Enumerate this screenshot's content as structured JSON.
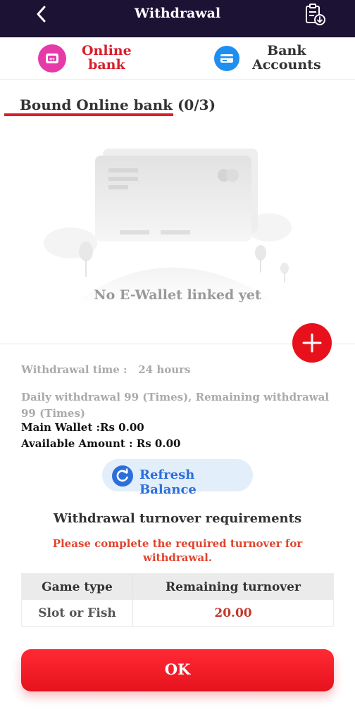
{
  "header": {
    "title": "Withdrawal",
    "back_icon": "chevron-left-icon",
    "record_icon": "clipboard-download-icon"
  },
  "tabs": [
    {
      "line1": "Online",
      "line2": "bank",
      "icon": "e-wallet-icon",
      "active": true
    },
    {
      "line1": "Bank",
      "line2": "Accounts",
      "icon": "bank-card-icon",
      "active": false
    }
  ],
  "bound": {
    "title": "Bound Online bank (0/3)",
    "empty_text": "No E-Wallet linked yet"
  },
  "add_icon": "plus-icon",
  "info": {
    "time_label": "Withdrawal time :   24 hours",
    "daily": "Daily withdrawal 99 (Times), Remaining withdrawal 99 (Times)",
    "main_wallet_label": "Main Wallet :",
    "main_wallet_value": "Rs 0.00",
    "available_label": "Available Amount : ",
    "available_value": "Rs 0.00"
  },
  "refresh": {
    "label": "Refresh Balance",
    "icon": "refresh-icon"
  },
  "turnover": {
    "title": "Withdrawal turnover requirements",
    "note": "Please complete the required turnover for withdrawal.",
    "headers": [
      "Game type",
      "Remaining turnover"
    ],
    "rows": [
      [
        "Slot or Fish",
        "20.00"
      ]
    ]
  },
  "ok_label": "OK",
  "colors": {
    "header_bg": "#1c1234",
    "accent_red": "#d81e2c",
    "button_red": "#e8101a",
    "refresh_blue": "#2d6fd9",
    "warning": "#e0442e"
  }
}
